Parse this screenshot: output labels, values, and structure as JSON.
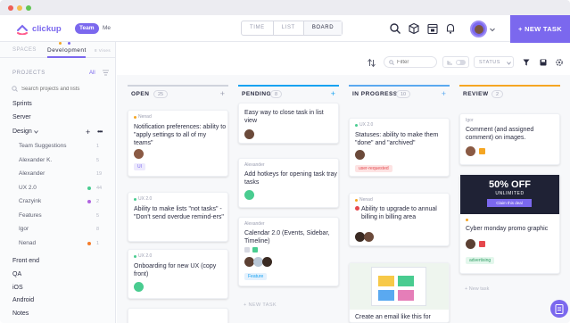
{
  "app": {
    "name": "clickup"
  },
  "colors": {
    "accent": "#7b68ee",
    "open": "#cfd3dc",
    "pending": "#17a2f1",
    "in_progress": "#5aa9f0",
    "review": "#f5a623"
  },
  "topbar": {
    "team_label": "Team",
    "me_label": "Me",
    "views": [
      "TIME",
      "LIST",
      "BOARD"
    ],
    "new_task": "+ NEW TASK"
  },
  "sidebar": {
    "tab_spaces": "SPACES",
    "tab_development": "Development",
    "tab_meta": "8 Vises",
    "projects_header": "PROJECTS",
    "projects_all": "All",
    "search_placeholder": "Search projects and lists",
    "items": [
      {
        "label": "Sprints"
      },
      {
        "label": "Server"
      },
      {
        "label": "Design"
      }
    ],
    "design_lists": [
      {
        "label": "Team Suggestions",
        "count": "1"
      },
      {
        "label": "Alexander K.",
        "count": "5"
      },
      {
        "label": "Alexander",
        "count": "19"
      },
      {
        "label": "UX 2.0",
        "count": "44"
      },
      {
        "label": "Crazyink",
        "count": "2"
      },
      {
        "label": "Features",
        "count": "5"
      },
      {
        "label": "Igor",
        "count": "8"
      },
      {
        "label": "Nenad",
        "count": "1"
      }
    ],
    "more_items": [
      {
        "label": "Front end"
      },
      {
        "label": "QA"
      },
      {
        "label": "iOS"
      },
      {
        "label": "Android"
      },
      {
        "label": "Notes"
      }
    ]
  },
  "toolbar": {
    "filter_placeholder": "Filter",
    "status_label": "STATUS"
  },
  "columns": [
    {
      "title": "OPEN",
      "count": "25"
    },
    {
      "title": "PENDING",
      "count": "8"
    },
    {
      "title": "IN PROGRESS",
      "count": "10"
    },
    {
      "title": "REVIEW",
      "count": "2"
    }
  ],
  "cards": {
    "open": [
      {
        "meta": "Nenad",
        "text": "Notification preferences: ability to \"apply settings to all of my teams\"",
        "tag": "UI"
      },
      {
        "meta": "UX 2.0",
        "text": "Ability to make lists \"not tasks\" - \"Don't send overdue remind-ers\""
      },
      {
        "meta": "UX 2.0",
        "text": "Onboarding for new UX (copy front)"
      }
    ],
    "pending": [
      {
        "text": "Easy way to close task in list view"
      },
      {
        "meta": "Alexander",
        "text": "Add hotkeys for opening task tray tasks"
      },
      {
        "meta": "Alexander",
        "text": "Calendar 2.0 (Events, Sidebar, Timeline)",
        "tag": "Feature"
      },
      {
        "add": "+ NEW TASK"
      }
    ],
    "in_progress": [
      {
        "meta": "UX 2.0",
        "text": "Statuses: ability to make them \"done\" and \"archived\"",
        "tag": "user-requested"
      },
      {
        "meta": "Nenad",
        "text": "Ability to upgrade to annual billing in billing area"
      },
      {
        "text": "Create an email like this for"
      }
    ],
    "review": [
      {
        "meta": "Igor",
        "text": "Comment (and assigned comment) on images."
      },
      {
        "promo_title": "50% OFF",
        "promo_sub": "UNLIMITED",
        "promo_btn": "Claim this deal",
        "text": "Cyber monday promo graphic",
        "tag": "advertising"
      },
      {
        "add": "+ New task"
      }
    ]
  }
}
